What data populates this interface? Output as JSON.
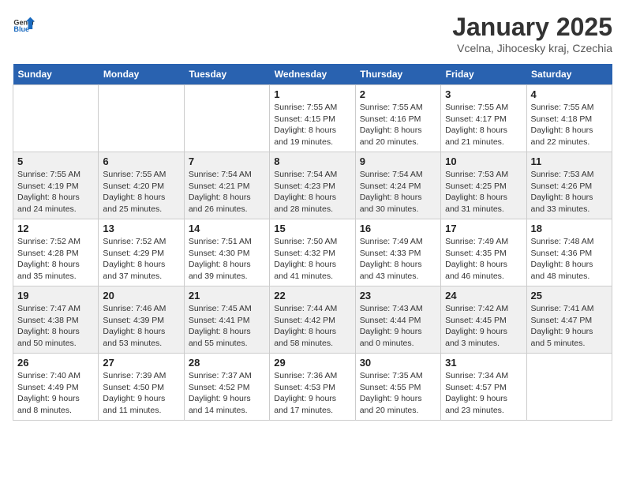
{
  "header": {
    "logo_general": "General",
    "logo_blue": "Blue",
    "month_title": "January 2025",
    "location": "Vcelna, Jihocesky kraj, Czechia"
  },
  "weekdays": [
    "Sunday",
    "Monday",
    "Tuesday",
    "Wednesday",
    "Thursday",
    "Friday",
    "Saturday"
  ],
  "weeks": [
    [
      {
        "day": "",
        "info": ""
      },
      {
        "day": "",
        "info": ""
      },
      {
        "day": "",
        "info": ""
      },
      {
        "day": "1",
        "info": "Sunrise: 7:55 AM\nSunset: 4:15 PM\nDaylight: 8 hours\nand 19 minutes."
      },
      {
        "day": "2",
        "info": "Sunrise: 7:55 AM\nSunset: 4:16 PM\nDaylight: 8 hours\nand 20 minutes."
      },
      {
        "day": "3",
        "info": "Sunrise: 7:55 AM\nSunset: 4:17 PM\nDaylight: 8 hours\nand 21 minutes."
      },
      {
        "day": "4",
        "info": "Sunrise: 7:55 AM\nSunset: 4:18 PM\nDaylight: 8 hours\nand 22 minutes."
      }
    ],
    [
      {
        "day": "5",
        "info": "Sunrise: 7:55 AM\nSunset: 4:19 PM\nDaylight: 8 hours\nand 24 minutes."
      },
      {
        "day": "6",
        "info": "Sunrise: 7:55 AM\nSunset: 4:20 PM\nDaylight: 8 hours\nand 25 minutes."
      },
      {
        "day": "7",
        "info": "Sunrise: 7:54 AM\nSunset: 4:21 PM\nDaylight: 8 hours\nand 26 minutes."
      },
      {
        "day": "8",
        "info": "Sunrise: 7:54 AM\nSunset: 4:23 PM\nDaylight: 8 hours\nand 28 minutes."
      },
      {
        "day": "9",
        "info": "Sunrise: 7:54 AM\nSunset: 4:24 PM\nDaylight: 8 hours\nand 30 minutes."
      },
      {
        "day": "10",
        "info": "Sunrise: 7:53 AM\nSunset: 4:25 PM\nDaylight: 8 hours\nand 31 minutes."
      },
      {
        "day": "11",
        "info": "Sunrise: 7:53 AM\nSunset: 4:26 PM\nDaylight: 8 hours\nand 33 minutes."
      }
    ],
    [
      {
        "day": "12",
        "info": "Sunrise: 7:52 AM\nSunset: 4:28 PM\nDaylight: 8 hours\nand 35 minutes."
      },
      {
        "day": "13",
        "info": "Sunrise: 7:52 AM\nSunset: 4:29 PM\nDaylight: 8 hours\nand 37 minutes."
      },
      {
        "day": "14",
        "info": "Sunrise: 7:51 AM\nSunset: 4:30 PM\nDaylight: 8 hours\nand 39 minutes."
      },
      {
        "day": "15",
        "info": "Sunrise: 7:50 AM\nSunset: 4:32 PM\nDaylight: 8 hours\nand 41 minutes."
      },
      {
        "day": "16",
        "info": "Sunrise: 7:49 AM\nSunset: 4:33 PM\nDaylight: 8 hours\nand 43 minutes."
      },
      {
        "day": "17",
        "info": "Sunrise: 7:49 AM\nSunset: 4:35 PM\nDaylight: 8 hours\nand 46 minutes."
      },
      {
        "day": "18",
        "info": "Sunrise: 7:48 AM\nSunset: 4:36 PM\nDaylight: 8 hours\nand 48 minutes."
      }
    ],
    [
      {
        "day": "19",
        "info": "Sunrise: 7:47 AM\nSunset: 4:38 PM\nDaylight: 8 hours\nand 50 minutes."
      },
      {
        "day": "20",
        "info": "Sunrise: 7:46 AM\nSunset: 4:39 PM\nDaylight: 8 hours\nand 53 minutes."
      },
      {
        "day": "21",
        "info": "Sunrise: 7:45 AM\nSunset: 4:41 PM\nDaylight: 8 hours\nand 55 minutes."
      },
      {
        "day": "22",
        "info": "Sunrise: 7:44 AM\nSunset: 4:42 PM\nDaylight: 8 hours\nand 58 minutes."
      },
      {
        "day": "23",
        "info": "Sunrise: 7:43 AM\nSunset: 4:44 PM\nDaylight: 9 hours\nand 0 minutes."
      },
      {
        "day": "24",
        "info": "Sunrise: 7:42 AM\nSunset: 4:45 PM\nDaylight: 9 hours\nand 3 minutes."
      },
      {
        "day": "25",
        "info": "Sunrise: 7:41 AM\nSunset: 4:47 PM\nDaylight: 9 hours\nand 5 minutes."
      }
    ],
    [
      {
        "day": "26",
        "info": "Sunrise: 7:40 AM\nSunset: 4:49 PM\nDaylight: 9 hours\nand 8 minutes."
      },
      {
        "day": "27",
        "info": "Sunrise: 7:39 AM\nSunset: 4:50 PM\nDaylight: 9 hours\nand 11 minutes."
      },
      {
        "day": "28",
        "info": "Sunrise: 7:37 AM\nSunset: 4:52 PM\nDaylight: 9 hours\nand 14 minutes."
      },
      {
        "day": "29",
        "info": "Sunrise: 7:36 AM\nSunset: 4:53 PM\nDaylight: 9 hours\nand 17 minutes."
      },
      {
        "day": "30",
        "info": "Sunrise: 7:35 AM\nSunset: 4:55 PM\nDaylight: 9 hours\nand 20 minutes."
      },
      {
        "day": "31",
        "info": "Sunrise: 7:34 AM\nSunset: 4:57 PM\nDaylight: 9 hours\nand 23 minutes."
      },
      {
        "day": "",
        "info": ""
      }
    ]
  ]
}
